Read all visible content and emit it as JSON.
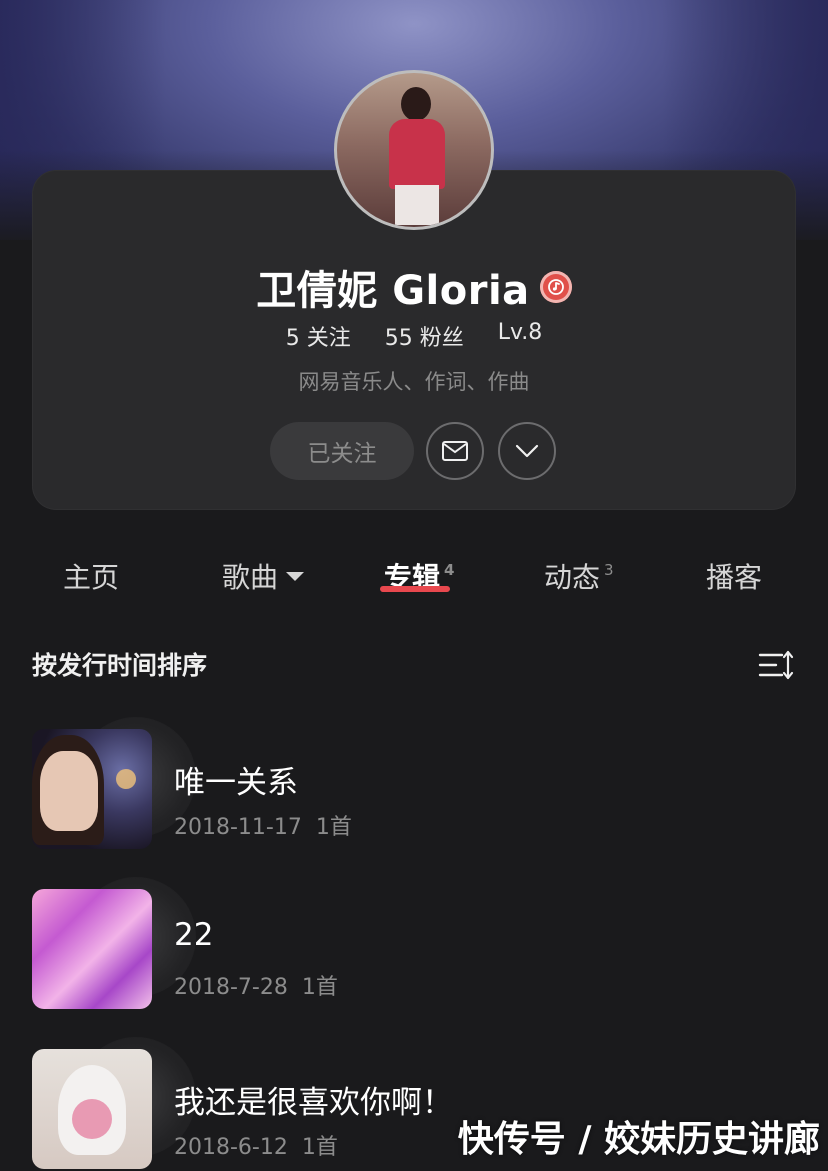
{
  "profile": {
    "name": "卫倩妮 Gloria",
    "badge_icon": "musician-badge-icon",
    "following_count": "5",
    "following_label": "关注",
    "followers_count": "55",
    "followers_label": "粉丝",
    "level": "Lv.8",
    "bio": "网易音乐人、作词、作曲",
    "follow_button_label": "已关注",
    "message_icon": "mail-icon",
    "more_icon": "chevron-down-icon",
    "accent_color": "#e8484e"
  },
  "tabs": [
    {
      "label": "主页"
    },
    {
      "label": "歌曲"
    },
    {
      "label": "专辑",
      "count": "4",
      "active": true
    },
    {
      "label": "动态",
      "count": "3"
    },
    {
      "label": "播客"
    }
  ],
  "sort": {
    "label": "按发行时间排序",
    "icon": "sort-icon"
  },
  "albums": [
    {
      "title": "唯一关系",
      "date": "2018-11-17",
      "tracks": "1首"
    },
    {
      "title": "22",
      "date": "2018-7-28",
      "tracks": "1首"
    },
    {
      "title": "我还是很喜欢你啊！",
      "date": "2018-6-12",
      "tracks": "1首"
    }
  ],
  "watermark": "快传号 / 姣妹历史讲廊"
}
